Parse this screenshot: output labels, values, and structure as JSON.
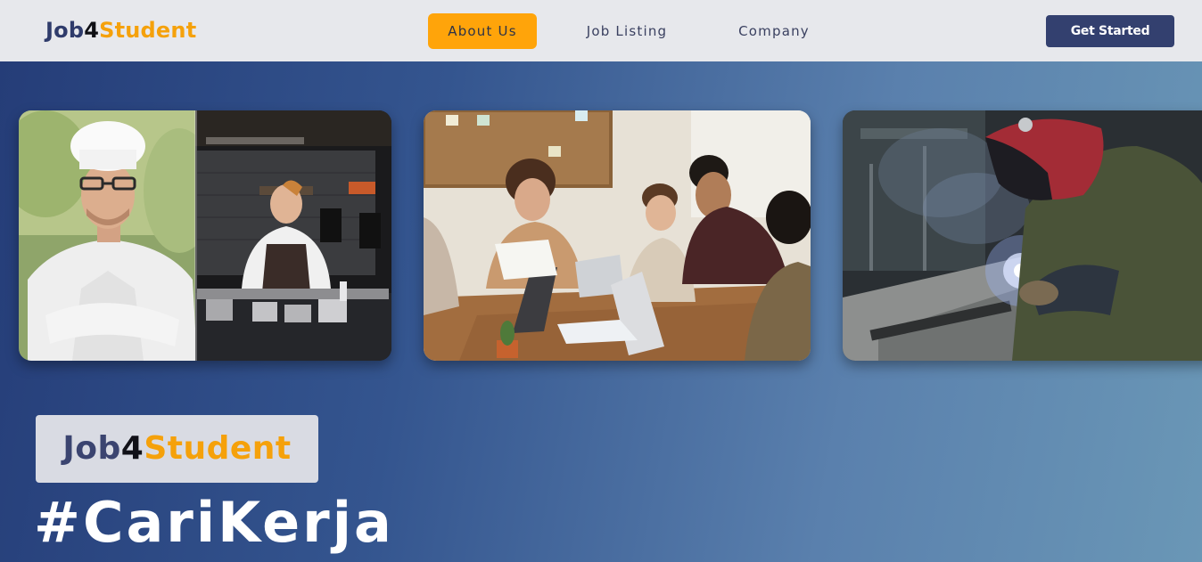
{
  "brand": {
    "part1": "Job",
    "part2": "4",
    "part3": "Student"
  },
  "nav": {
    "about": "About Us",
    "jobs": "Job Listing",
    "company": "Company"
  },
  "cta": {
    "get_started": "Get Started"
  },
  "hero": {
    "badge": {
      "part1": "Job",
      "part2": "4",
      "part3": "Student"
    },
    "hashtag": "#CariKerja",
    "images": [
      "chef-photo",
      "team-meeting-photo",
      "welder-photo"
    ]
  },
  "colors": {
    "brand_navy": "#2f3b6b",
    "brand_orange": "#f5a10b",
    "nav_active_bg": "#ffa40a",
    "button_bg": "#33406f",
    "hero_gradient_start": "#253d78",
    "hero_gradient_end": "#6a97b6"
  }
}
